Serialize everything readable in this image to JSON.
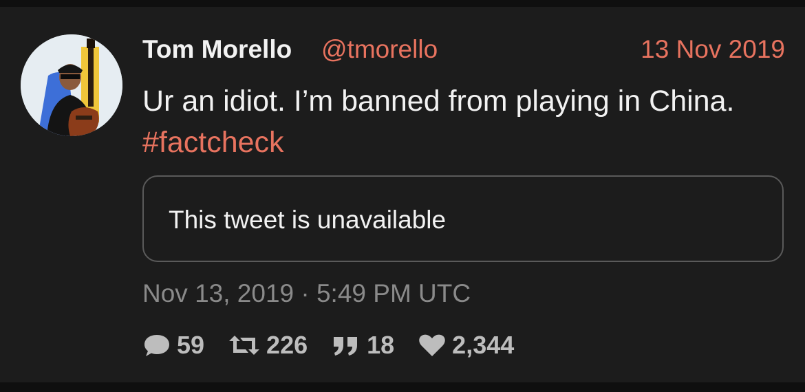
{
  "tweet": {
    "fullname": "Tom Morello",
    "username": "@tmorello",
    "date": "13 Nov 2019",
    "text": "Ur an idiot. I’m banned from playing in China.",
    "hashtag": "#factcheck",
    "quote_text": "This tweet is unavailable",
    "published": "Nov 13, 2019 · 5:49 PM UTC",
    "stats": {
      "replies": "59",
      "retweets": "226",
      "quotes": "18",
      "likes": "2,344"
    }
  },
  "colors": {
    "background": "#1c1c1c",
    "accent": "#e8735f",
    "text": "#f2f2f2",
    "muted": "#8a8a8a",
    "stat": "#bdbdbd",
    "border": "#5a5a5a"
  },
  "icons": {
    "replies": "comment-icon",
    "retweets": "retweet-icon",
    "quotes": "quote-icon",
    "likes": "heart-icon"
  }
}
